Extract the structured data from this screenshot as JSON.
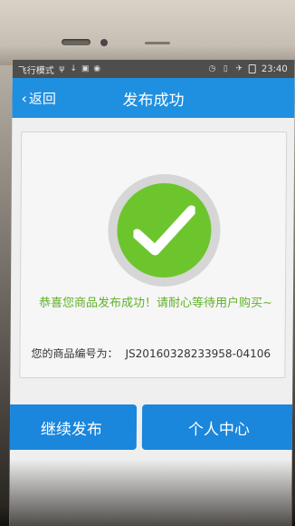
{
  "status_bar": {
    "mode": "飞行模式",
    "time": "23:40"
  },
  "header": {
    "back_label": "返回",
    "title": "发布成功"
  },
  "result": {
    "message": "恭喜您商品发布成功！请耐心等待用户购买~",
    "order_label": "您的商品编号为：",
    "order_number": "JS20160328233958-04106"
  },
  "actions": {
    "continue_label": "继续发布",
    "profile_label": "个人中心"
  },
  "colors": {
    "appbar": "#1f8fe0",
    "success_green": "#6dc52e",
    "button_blue": "#1a86dc"
  },
  "icons": [
    "usb-icon",
    "download-icon",
    "lock-icon",
    "notification-icon",
    "alarm-icon",
    "vibrate-icon",
    "airplane-icon",
    "battery-icon",
    "check-icon"
  ]
}
